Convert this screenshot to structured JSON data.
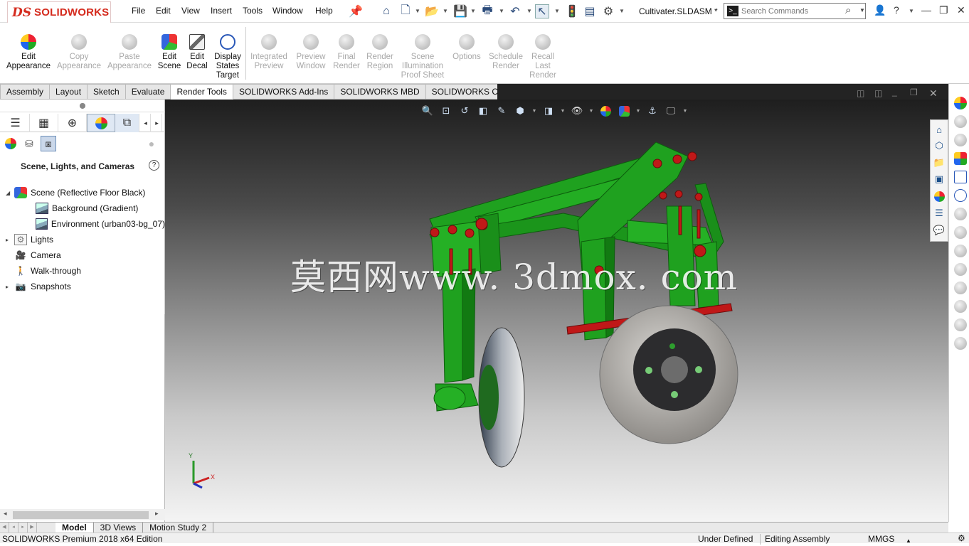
{
  "app": {
    "brand_ds": "DS",
    "brand_name": "SOLIDWORKS",
    "document_title": "Cultivater.SLDASM *"
  },
  "menu": [
    "File",
    "Edit",
    "View",
    "Insert",
    "Tools",
    "Window",
    "Help"
  ],
  "search": {
    "placeholder": "Search Commands"
  },
  "ribbon": {
    "buttons": [
      {
        "label": "Edit Appearance",
        "enabled": true,
        "icon": "appearance-icon"
      },
      {
        "label": "Copy Appearance",
        "enabled": false,
        "icon": "copy-appearance-icon"
      },
      {
        "label": "Paste Appearance",
        "enabled": false,
        "icon": "paste-appearance-icon"
      },
      {
        "label": "Edit Scene",
        "enabled": true,
        "icon": "scene-icon"
      },
      {
        "label": "Edit Decal",
        "enabled": true,
        "icon": "decal-icon"
      },
      {
        "label": "Display States Target",
        "enabled": true,
        "icon": "target-icon"
      },
      {
        "label": "Integrated Preview",
        "enabled": false,
        "icon": "integrated-preview-icon"
      },
      {
        "label": "Preview Window",
        "enabled": false,
        "icon": "preview-window-icon"
      },
      {
        "label": "Final Render",
        "enabled": false,
        "icon": "final-render-icon"
      },
      {
        "label": "Render Region",
        "enabled": false,
        "icon": "render-region-icon"
      },
      {
        "label": "Scene Illumination Proof Sheet",
        "enabled": false,
        "icon": "proof-sheet-icon"
      },
      {
        "label": "Options",
        "enabled": false,
        "icon": "options-icon"
      },
      {
        "label": "Schedule Render",
        "enabled": false,
        "icon": "schedule-render-icon"
      },
      {
        "label": "Recall Last Render",
        "enabled": false,
        "icon": "recall-render-icon"
      }
    ]
  },
  "command_tabs": [
    "Assembly",
    "Layout",
    "Sketch",
    "Evaluate",
    "Render Tools",
    "SOLIDWORKS Add-Ins",
    "SOLIDWORKS MBD",
    "SOLIDWORKS CAM"
  ],
  "active_command_tab": "Render Tools",
  "panel": {
    "title": "Scene, Lights, and Cameras",
    "tree": [
      {
        "label": "Scene (Reflective Floor Black)",
        "expandable": true,
        "expanded": true,
        "icon": "scene-icon"
      },
      {
        "label": "Background (Gradient)",
        "expandable": false,
        "icon": "background-icon"
      },
      {
        "label": "Environment (urban03-bg_07)",
        "expandable": false,
        "icon": "environment-icon"
      },
      {
        "label": "Lights",
        "expandable": true,
        "expanded": false,
        "icon": "lights-icon"
      },
      {
        "label": "Camera",
        "expandable": false,
        "icon": "camera-icon"
      },
      {
        "label": "Walk-through",
        "expandable": false,
        "icon": "walk-through-icon"
      },
      {
        "label": "Snapshots",
        "expandable": true,
        "expanded": false,
        "icon": "snapshots-icon"
      }
    ]
  },
  "viewport": {
    "watermark": "莫西网www. 3dmox. com",
    "triad_y": "Y",
    "triad_x": "X",
    "colors": {
      "frame": "#1fa11f",
      "frame_dark": "#0f6e0f",
      "bolts": "#c01818",
      "disc": "#b8b8b8"
    }
  },
  "bottom_tabs": [
    "Model",
    "3D Views",
    "Motion Study 2"
  ],
  "active_bottom_tab": "Model",
  "status": {
    "product": "SOLIDWORKS Premium 2018 x64 Edition",
    "definition": "Under Defined",
    "mode": "Editing Assembly",
    "units": "MMGS"
  }
}
